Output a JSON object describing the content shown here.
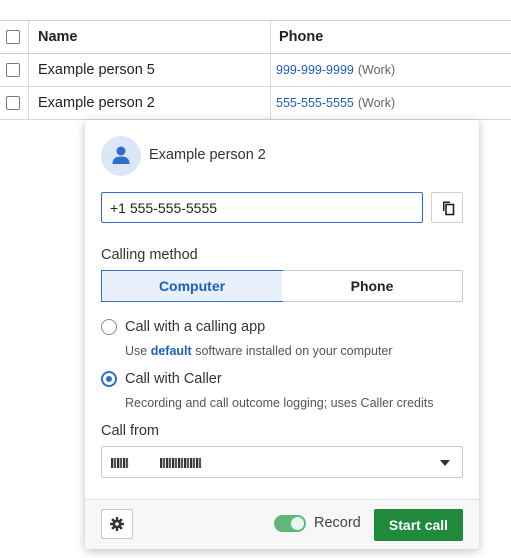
{
  "table": {
    "headers": {
      "name": "Name",
      "phone": "Phone"
    },
    "rows": [
      {
        "name": "Example person 5",
        "phone": "999-999-9999",
        "phone_type": "(Work)"
      },
      {
        "name": "Example person 2",
        "phone": "555-555-5555",
        "phone_type": "(Work)"
      }
    ]
  },
  "popup": {
    "contact_name": "Example person 2",
    "avatar_icon": "person-icon",
    "phone_value": "+1 555-555-5555",
    "copy_icon": "copy-icon",
    "calling_method": {
      "label": "Calling method",
      "options": [
        "Computer",
        "Phone"
      ],
      "selected": "Computer"
    },
    "options": [
      {
        "label": "Call with a calling app",
        "desc_prefix": "Use",
        "desc_link": "default",
        "desc_suffix": "software installed on your computer",
        "checked": false
      },
      {
        "label": "Call with Caller",
        "desc": "Recording and call outcome logging; uses Caller credits",
        "checked": true
      }
    ],
    "call_from": {
      "label": "Call from"
    },
    "footer": {
      "settings_icon": "gear-icon",
      "record_label": "Record",
      "record_on": true,
      "start_label": "Start call"
    }
  },
  "colors": {
    "accent": "#2f6fc9",
    "link": "#1d5fbf",
    "start": "#1f8a3c",
    "toggle": "#5fb87a"
  }
}
